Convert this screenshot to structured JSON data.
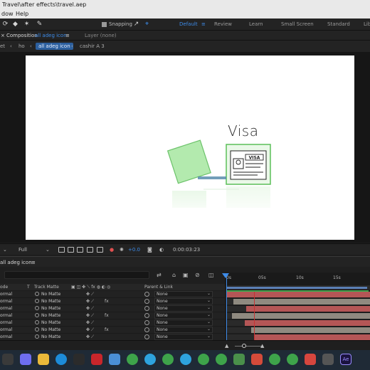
{
  "window": {
    "title": "Travel\\after effects\\travel.aep"
  },
  "menu": {
    "items": [
      "dow",
      "Help"
    ]
  },
  "toolbar": {
    "snapping_label": "Snapping",
    "workspaces": [
      "Default",
      "Review",
      "Learn",
      "Small Screen",
      "Standard",
      "Lib"
    ],
    "active_workspace": "Default"
  },
  "panel": {
    "composition_label": "Composition",
    "composition_name": "all adeg icon",
    "layer_label": "Layer (none)",
    "breadcrumbs": [
      "ho",
      "all adeg icon",
      "cashir A 3"
    ],
    "breadcrumb_prefix": "et"
  },
  "canvas": {
    "heading": "Visa",
    "card_label": "VISA",
    "accent_color": "#7fd67a"
  },
  "viewer_bar": {
    "resolution": "Full",
    "exposure": "+0.0",
    "timecode": "0:00:03:23"
  },
  "timeline": {
    "tab_label": "all adeg icon",
    "columns": {
      "mode": "ode",
      "t": "T",
      "track_matte": "Track Matte",
      "parent": "Parent & Link"
    },
    "ruler_ticks": [
      "0s",
      "05s",
      "10s",
      "15s"
    ],
    "rows": [
      {
        "mode": "ormal",
        "matte": "No Matte",
        "parent": "None"
      },
      {
        "mode": "ormal",
        "matte": "No Matte",
        "parent": "None"
      },
      {
        "mode": "ormal",
        "matte": "No Matte",
        "parent": "None"
      },
      {
        "mode": "ormal",
        "matte": "No Matte",
        "parent": "None"
      },
      {
        "mode": "ormal",
        "matte": "No Matte",
        "parent": "None"
      },
      {
        "mode": "ormal",
        "matte": "No Matte",
        "parent": "None"
      },
      {
        "mode": "ormal",
        "matte": "No Matte",
        "parent": "None"
      }
    ],
    "layer_bar_colors": [
      "#b45656",
      "#8f8a80",
      "#b45656",
      "#8f8a80",
      "#b45656",
      "#8f8a80",
      "#b45656"
    ],
    "workarea_color": "#5a7fb5",
    "playhead_color": "#3d8be8"
  },
  "taskbar": {
    "apps": [
      "start-icon",
      "copilot-icon",
      "folder-icon",
      "edge-icon",
      "settings-icon",
      "mcafee-icon",
      "files-icon",
      "chrome-icon",
      "telegram-icon",
      "chrome-icon",
      "telegram-icon",
      "chrome-icon",
      "chrome-icon",
      "maps-icon",
      "mail-icon",
      "chrome-icon",
      "chrome-icon",
      "record-icon",
      "camera-icon",
      "aftereffects-icon"
    ]
  }
}
